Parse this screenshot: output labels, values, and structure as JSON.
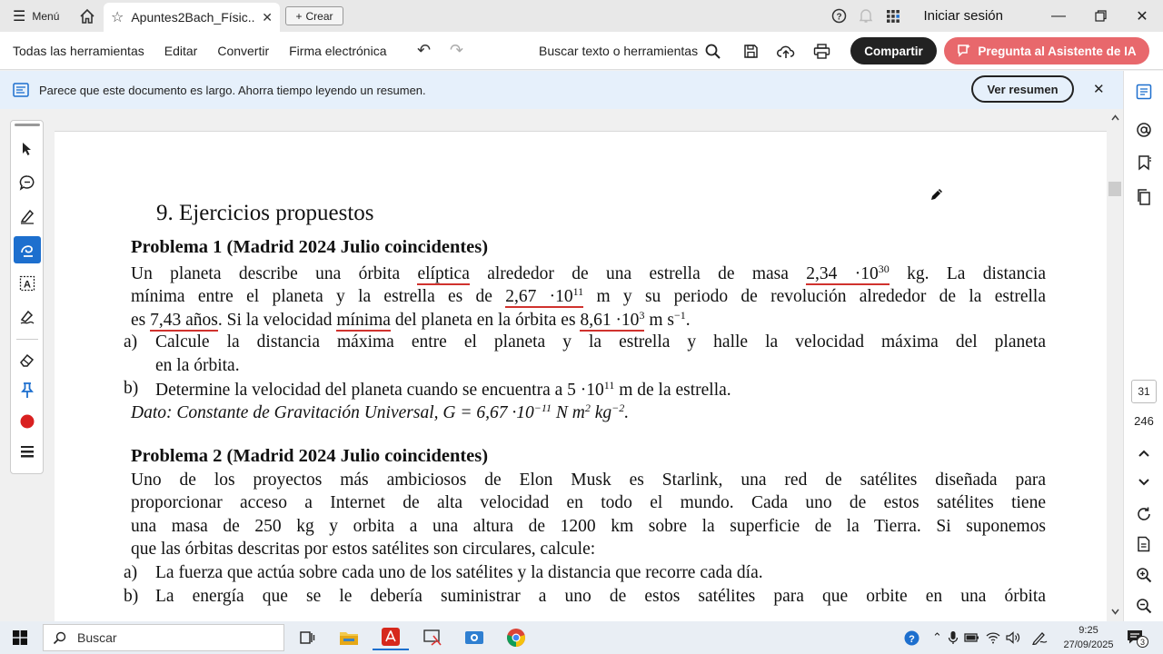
{
  "titlebar": {
    "menu_label": "Menú",
    "tab_title": "Apuntes2Bach_Físic...",
    "create_label": "Crear",
    "signin_label": "Iniciar sesión"
  },
  "toolbar": {
    "items": [
      "Todas las herramientas",
      "Editar",
      "Convertir",
      "Firma electrónica"
    ],
    "search_label": "Buscar texto o herramientas",
    "share_label": "Compartir",
    "ai_label": "Pregunta al Asistente de IA"
  },
  "banner": {
    "text": "Parece que este documento es largo. Ahorra tiempo leyendo un resumen.",
    "button_label": "Ver resumen"
  },
  "navigation": {
    "current_page": "31",
    "total_pages": "246"
  },
  "document": {
    "section_title": "9. Ejercicios propuestos",
    "problem1": {
      "title": "Problema 1 (Madrid 2024 Julio coincidentes)",
      "text_a": "Un planeta describe una órbita",
      "eliptica": "elíptica",
      "text_b": "alrededor de una estrella de masa",
      "mass_mant": "2,34 ·10",
      "mass_exp": "30",
      "text_c": "kg. La distancia",
      "text_d": "mínima entre el planeta y la estrella es de",
      "dist_mant": "2,67 ·10",
      "dist_exp": "11",
      "text_e": "m y su periodo de revolución alrededor de la estrella",
      "text_f": "es",
      "period": "7,43 años",
      "text_g": ". Si la velocidad",
      "minima": "mínima",
      "text_h": "del planeta en la órbita es",
      "vel_mant": "8,61 ·10",
      "vel_exp": "3",
      "text_i": "m s",
      "vel_unit_exp": "−1",
      "text_j": ".",
      "item_a_letter": "a)",
      "item_a_line1": "Calcule la distancia máxima entre el planeta y la estrella y halle la velocidad máxima del planeta",
      "item_a_line2": "en la órbita.",
      "item_b_letter": "b)",
      "item_b_text": "Determine la velocidad del planeta cuando se encuentra a 5 ·10",
      "item_b_exp": "11",
      "item_b_end": "m de la estrella.",
      "dato_text": "Dato: Constante de Gravitación Universal, G = 6,67 ·10",
      "dato_exp": "−11",
      "dato_units": "N m",
      "dato_units_exp1": "2",
      "dato_units_b": "kg",
      "dato_units_exp2": "−2",
      "dato_end": "."
    },
    "problem2": {
      "title": "Problema 2 (Madrid 2024 Julio coincidentes)",
      "line1": "Uno de los proyectos más ambiciosos de Elon Musk es Starlink, una red de satélites diseñada para",
      "line2": "proporcionar acceso a Internet de alta velocidad en todo el mundo. Cada uno de estos satélites tiene",
      "line3": "una masa de 250 kg y orbita a una altura de 1200 km sobre la superficie de la Tierra. Si suponemos",
      "line4": "que las órbitas descritas por estos satélites son circulares, calcule:",
      "item_a_letter": "a)",
      "item_a_text": "La fuerza que actúa sobre cada uno de los satélites y la distancia que recorre cada día.",
      "item_b_letter": "b)",
      "item_b_text": "La energía que se le debería suministrar a uno de estos satélites para que orbite en una órbita"
    }
  },
  "taskbar": {
    "search_placeholder": "Buscar",
    "time": "9:25",
    "date": "27/09/2025",
    "notification_count": "3"
  }
}
